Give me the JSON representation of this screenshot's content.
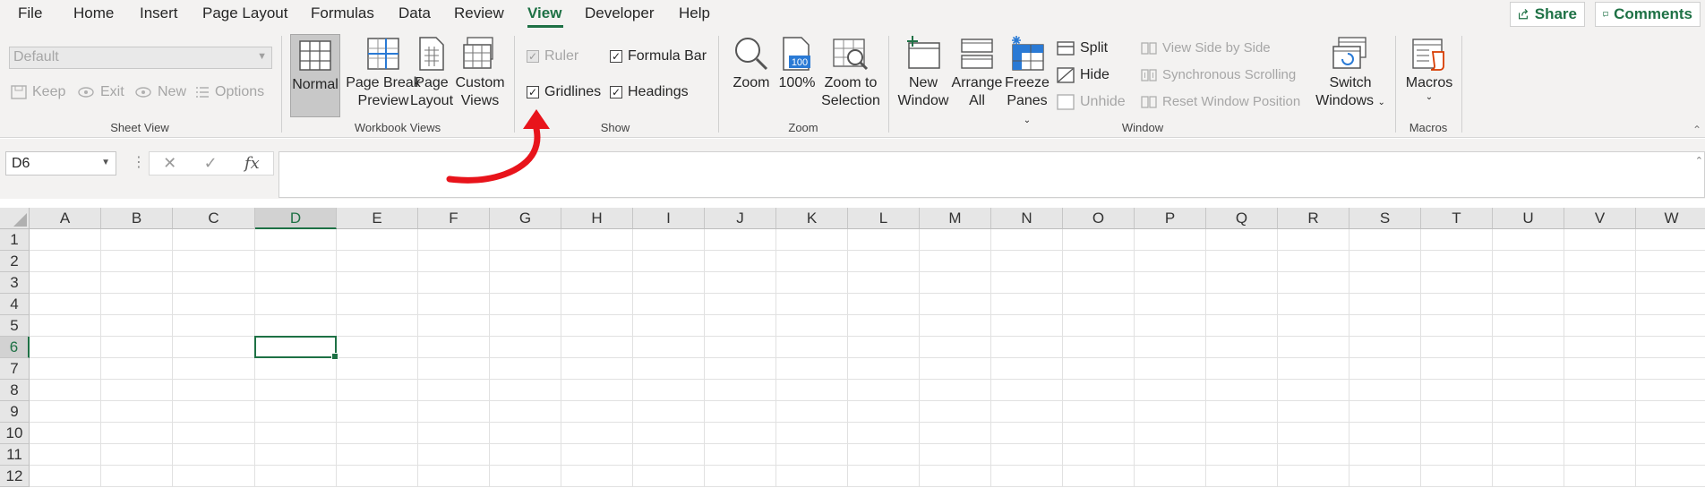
{
  "menu": {
    "items": [
      "File",
      "Home",
      "Insert",
      "Page Layout",
      "Formulas",
      "Data",
      "Review",
      "View",
      "Developer",
      "Help"
    ],
    "active": "View",
    "share_label": "Share",
    "comments_label": "Comments"
  },
  "sheet_view": {
    "dropdown_value": "Default",
    "keep": "Keep",
    "exit": "Exit",
    "new": "New",
    "options": "Options",
    "group_label": "Sheet View"
  },
  "workbook_views": {
    "normal": "Normal",
    "page_break_1": "Page Break",
    "page_break_2": "Preview",
    "page_layout_1": "Page",
    "page_layout_2": "Layout",
    "custom_1": "Custom",
    "custom_2": "Views",
    "group_label": "Workbook Views"
  },
  "show": {
    "ruler": "Ruler",
    "formula_bar": "Formula Bar",
    "gridlines": "Gridlines",
    "headings": "Headings",
    "group_label": "Show"
  },
  "zoom": {
    "zoom": "Zoom",
    "hundred": "100%",
    "hundred_icon": "100",
    "zoom_sel_1": "Zoom to",
    "zoom_sel_2": "Selection",
    "group_label": "Zoom"
  },
  "window": {
    "new_1": "New",
    "new_2": "Window",
    "arrange_1": "Arrange",
    "arrange_2": "All",
    "freeze_1": "Freeze",
    "freeze_2": "Panes",
    "split": "Split",
    "hide": "Hide",
    "unhide": "Unhide",
    "side_by_side": "View Side by Side",
    "sync_scroll": "Synchronous Scrolling",
    "reset_pos": "Reset Window Position",
    "switch_1": "Switch",
    "switch_2": "Windows",
    "group_label": "Window"
  },
  "macros": {
    "label": "Macros",
    "group_label": "Macros"
  },
  "formula_bar": {
    "name_box": "D6",
    "fx": "fx",
    "value": ""
  },
  "sheet": {
    "columns": [
      "A",
      "B",
      "C",
      "D",
      "E",
      "F",
      "G",
      "H",
      "I",
      "J",
      "K",
      "L",
      "M",
      "N",
      "O",
      "P",
      "Q",
      "R",
      "S",
      "T",
      "U",
      "V",
      "W"
    ],
    "rows": [
      "1",
      "2",
      "3",
      "4",
      "5",
      "6",
      "7",
      "8",
      "9",
      "10",
      "11",
      "12"
    ],
    "selected_column": "D",
    "selected_row": "6"
  },
  "colors": {
    "accent": "#1e7145",
    "annotation_arrow": "#e8141b"
  }
}
